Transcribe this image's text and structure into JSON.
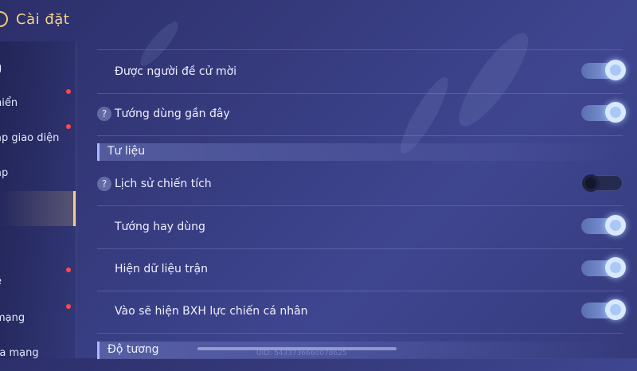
{
  "header": {
    "title": "Cài đặt"
  },
  "sidebar": {
    "items": [
      {
        "label": "g",
        "dot": false
      },
      {
        "label": "hiển",
        "dot": true
      },
      {
        "label": "ập giao diện",
        "dot": true
      },
      {
        "label": "ập",
        "dot": false
      },
      {
        "label": "",
        "dot": false,
        "active": true
      },
      {
        "label": "",
        "dot": false
      },
      {
        "label": "ệ",
        "dot": true
      },
      {
        "label": " mạng",
        "dot": true
      },
      {
        "label": "ra mạng",
        "dot": false
      }
    ]
  },
  "settings": {
    "rows_top": [
      {
        "label": "Được người đề cử mời",
        "help": false,
        "toggle": "on"
      },
      {
        "label": "Tướng dùng gần đây",
        "help": true,
        "toggle": "on"
      }
    ],
    "section_tu_lieu": "Tư liệu",
    "rows_tu_lieu": [
      {
        "label": "Lịch sử chiến tích",
        "help": true,
        "toggle": "off"
      },
      {
        "label": "Tướng hay dùng",
        "help": false,
        "toggle": "on"
      },
      {
        "label": "Hiện dữ liệu trận",
        "help": false,
        "toggle": "on"
      },
      {
        "label": "Vào sẽ hiện BXH lực chiến cá nhân",
        "help": false,
        "toggle": "on"
      }
    ],
    "section_do_tuong": "Độ tương",
    "help_glyph": "?"
  },
  "footer": {
    "uid": "UID: 5433736660078625"
  },
  "colors": {
    "accent_gold": "#f5d48a",
    "badge_red": "#ff4a4a",
    "toggle_on": "#8fa6e6"
  }
}
